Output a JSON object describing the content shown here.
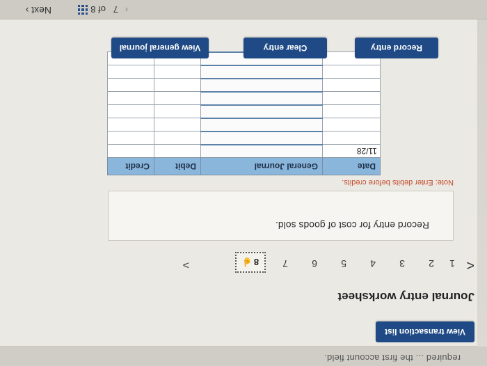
{
  "top": {
    "cut_text": "required ... the first account field."
  },
  "buttons": {
    "view_transaction_list": "View transaction list",
    "record_entry": "Record entry",
    "clear_entry": "Clear entry",
    "view_general_journal": "View general journal"
  },
  "worksheet": {
    "title": "Journal entry worksheet",
    "prev": "<",
    "next": ">",
    "pages": [
      "1",
      "2",
      "3",
      "4",
      "5",
      "6",
      "7"
    ],
    "current": "8"
  },
  "instruction": "Record entry for cost of goods sold.",
  "note": "Note: Enter debits before credits.",
  "table": {
    "headers": {
      "date": "Date",
      "journal": "General Journal",
      "debit": "Debit",
      "credit": "Credit"
    },
    "rows": [
      {
        "date": "11/28",
        "journal": "",
        "debit": "",
        "credit": ""
      },
      {
        "date": "",
        "journal": "",
        "debit": "",
        "credit": ""
      },
      {
        "date": "",
        "journal": "",
        "debit": "",
        "credit": ""
      },
      {
        "date": "",
        "journal": "",
        "debit": "",
        "credit": ""
      },
      {
        "date": "",
        "journal": "",
        "debit": "",
        "credit": ""
      },
      {
        "date": "",
        "journal": "",
        "debit": "",
        "credit": ""
      },
      {
        "date": "",
        "journal": "",
        "debit": "",
        "credit": ""
      },
      {
        "date": "",
        "journal": "",
        "debit": "",
        "credit": ""
      }
    ]
  },
  "footer": {
    "page": "7",
    "page_alt": "8",
    "of": "of 8",
    "next": "Next",
    "sep": "‹"
  }
}
